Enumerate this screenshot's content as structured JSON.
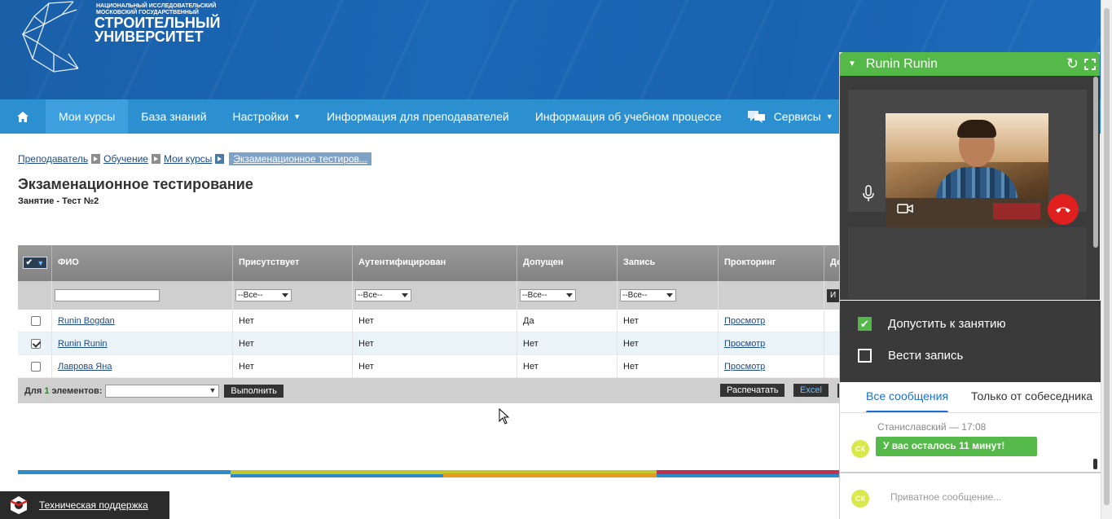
{
  "header": {
    "logo_line1": "НАЦИОНАЛЬНЫЙ ИССЛЕДОВАТЕЛЬСКИЙ",
    "logo_line2": "МОСКОВСКИЙ ГОСУДАРСТВЕННЫЙ",
    "logo_line3": "СТРОИТЕЛЬНЫЙ",
    "logo_line4": "УНИВЕРСИТЕТ"
  },
  "nav": {
    "home_icon": "home-icon",
    "items": [
      {
        "label": "Мои курсы",
        "active": true
      },
      {
        "label": "База знаний"
      },
      {
        "label": "Настройки",
        "dropdown": true
      },
      {
        "label": "Информация для преподавателей"
      },
      {
        "label": "Информация об учебном процессе"
      },
      {
        "label": "Сервисы",
        "dropdown": true,
        "icon": "chat-icon"
      }
    ]
  },
  "breadcrumb": [
    "Преподаватель",
    "Обучение",
    "Мои курсы",
    "Экзаменационное тестиров..."
  ],
  "page": {
    "title": "Экзаменационное тестирование",
    "subtitle": "Занятие - Тест №2"
  },
  "table": {
    "columns": [
      "ФИО",
      "Присутствует",
      "Аутентифицирован",
      "Допущен",
      "Запись",
      "Прокторинг",
      "Де"
    ],
    "filter_placeholder": "--Все--",
    "filter_action": "И",
    "rows": [
      {
        "name": "Runin Bogdan",
        "present": "Нет",
        "auth": "Нет",
        "admitted": "Да",
        "record": "Нет",
        "proctoring": "Просмотр",
        "checked": false
      },
      {
        "name": "Runin Runin",
        "present": "Нет",
        "auth": "Нет",
        "admitted": "Нет",
        "record": "Нет",
        "proctoring": "Просмотр",
        "checked": true
      },
      {
        "name": "Лаврова Яна",
        "present": "Нет",
        "auth": "Нет",
        "admitted": "Нет",
        "record": "Нет",
        "proctoring": "Просмотр",
        "checked": false
      }
    ],
    "footer_prefix": "Для",
    "footer_count": "1",
    "footer_suffix": "элементов:",
    "execute_label": "Выполнить",
    "print_label": "Распечатать",
    "excel_label": "Excel"
  },
  "support_label": "Техническая поддержка",
  "widget": {
    "title": "Runin Runin",
    "option_admit": "Допустить к занятию",
    "option_admit_checked": true,
    "option_record": "Вести запись",
    "option_record_checked": false,
    "tab_all": "Все сообщения",
    "tab_partner": "Только от собеседника",
    "msg_author": "Станиславский — 17:08",
    "msg_text": "У вас осталось 11 минут!",
    "avatar_initials": "СК",
    "input_placeholder": "Приватное сообщение...",
    "colors": {
      "green": "#54b948",
      "accent": "#1a6fd0",
      "hangup": "#e0201e"
    }
  }
}
